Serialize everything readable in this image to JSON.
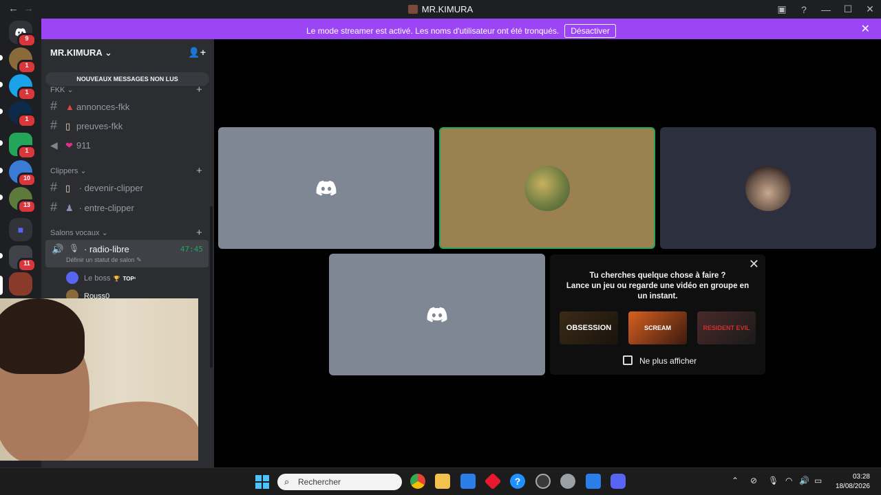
{
  "titlebar": {
    "title": "MR.KIMURA",
    "back": "←",
    "forward": "→",
    "inbox_icon": "inbox-icon",
    "help": "?",
    "minimize": "—",
    "maximize": "☐",
    "close": "✕"
  },
  "banner": {
    "text": "Le mode streamer est activé. Les noms d'utilisateur ont été tronqués.",
    "button": "Désactiver",
    "close": "✕"
  },
  "servers": {
    "home_badge": "9",
    "items": [
      {
        "icon": "server-avatar-1",
        "badge": "1"
      },
      {
        "icon": "server-avatar-2",
        "badge": "1"
      },
      {
        "icon": "server-avatar-3",
        "badge": "1"
      },
      {
        "icon": "server-avatar-4",
        "badge": "1"
      },
      {
        "icon": "server-avatar-5",
        "badge": "10"
      },
      {
        "icon": "server-avatar-6",
        "badge": "13"
      },
      {
        "icon": "folder-icon",
        "badge": ""
      },
      {
        "icon": "server-avatar-7",
        "badge": "11"
      },
      {
        "icon": "server-avatar-8",
        "badge": ""
      }
    ]
  },
  "sidebar": {
    "server_name": "MR.KIMURA",
    "unread_banner": "NOUVEAUX MESSAGES NON LUS",
    "categories": [
      {
        "name": "FKK",
        "channels": [
          "annonces-fkk",
          "preuves-fkk",
          "911"
        ]
      },
      {
        "name": "Clippers",
        "channels": [
          "devenir-clipper",
          "entre-clipper"
        ]
      },
      {
        "name": "Salons vocaux",
        "channels": [
          "radio-libre"
        ]
      }
    ],
    "voice": {
      "name": "radio-libre",
      "timer": "47:45",
      "status": "Définir un statut de salon",
      "members": [
        {
          "name": "Le boss",
          "tag": "TOP¹"
        },
        {
          "name": "Rouss0",
          "tag": ""
        }
      ]
    }
  },
  "activity": {
    "line1": "Tu cherches quelque chose à faire ?",
    "line2": "Lance un jeu ou regarde une vidéo en groupe en un instant.",
    "games": [
      "OBSESSION",
      "SCREAM",
      "RESIDENT EVIL"
    ],
    "checkbox_label": "Ne plus afficher"
  },
  "taskbar": {
    "search_placeholder": "Rechercher",
    "time": "03:28",
    "date": "18/08/2026"
  },
  "colors": {
    "banner": "#9b45f5",
    "speaking_border": "#23a55a",
    "tile_gray": "#7f8694",
    "tile_tan": "#9b8050",
    "tile_dark": "#2c2f3e"
  }
}
